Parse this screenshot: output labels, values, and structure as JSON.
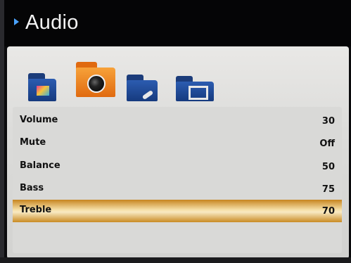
{
  "menu": {
    "title": "Audio"
  },
  "category_icons": [
    {
      "icon": "picture-folder-icon",
      "active": false
    },
    {
      "icon": "audio-folder-icon",
      "active": true
    },
    {
      "icon": "setup-folder-icon",
      "active": false
    },
    {
      "icon": "screen-folder-icon",
      "active": false
    }
  ],
  "settings": [
    {
      "label": "Volume",
      "value": "30"
    },
    {
      "label": "Mute",
      "value": "Off"
    },
    {
      "label": "Balance",
      "value": "50"
    },
    {
      "label": "Bass",
      "value": "75"
    },
    {
      "label": "Treble",
      "value": "70"
    }
  ],
  "colors": {
    "title_arrow": "#4aa3ff",
    "selected_highlight": "#f6e0a8",
    "active_folder": "#e06a10",
    "folder_blue": "#2c5cb0"
  }
}
